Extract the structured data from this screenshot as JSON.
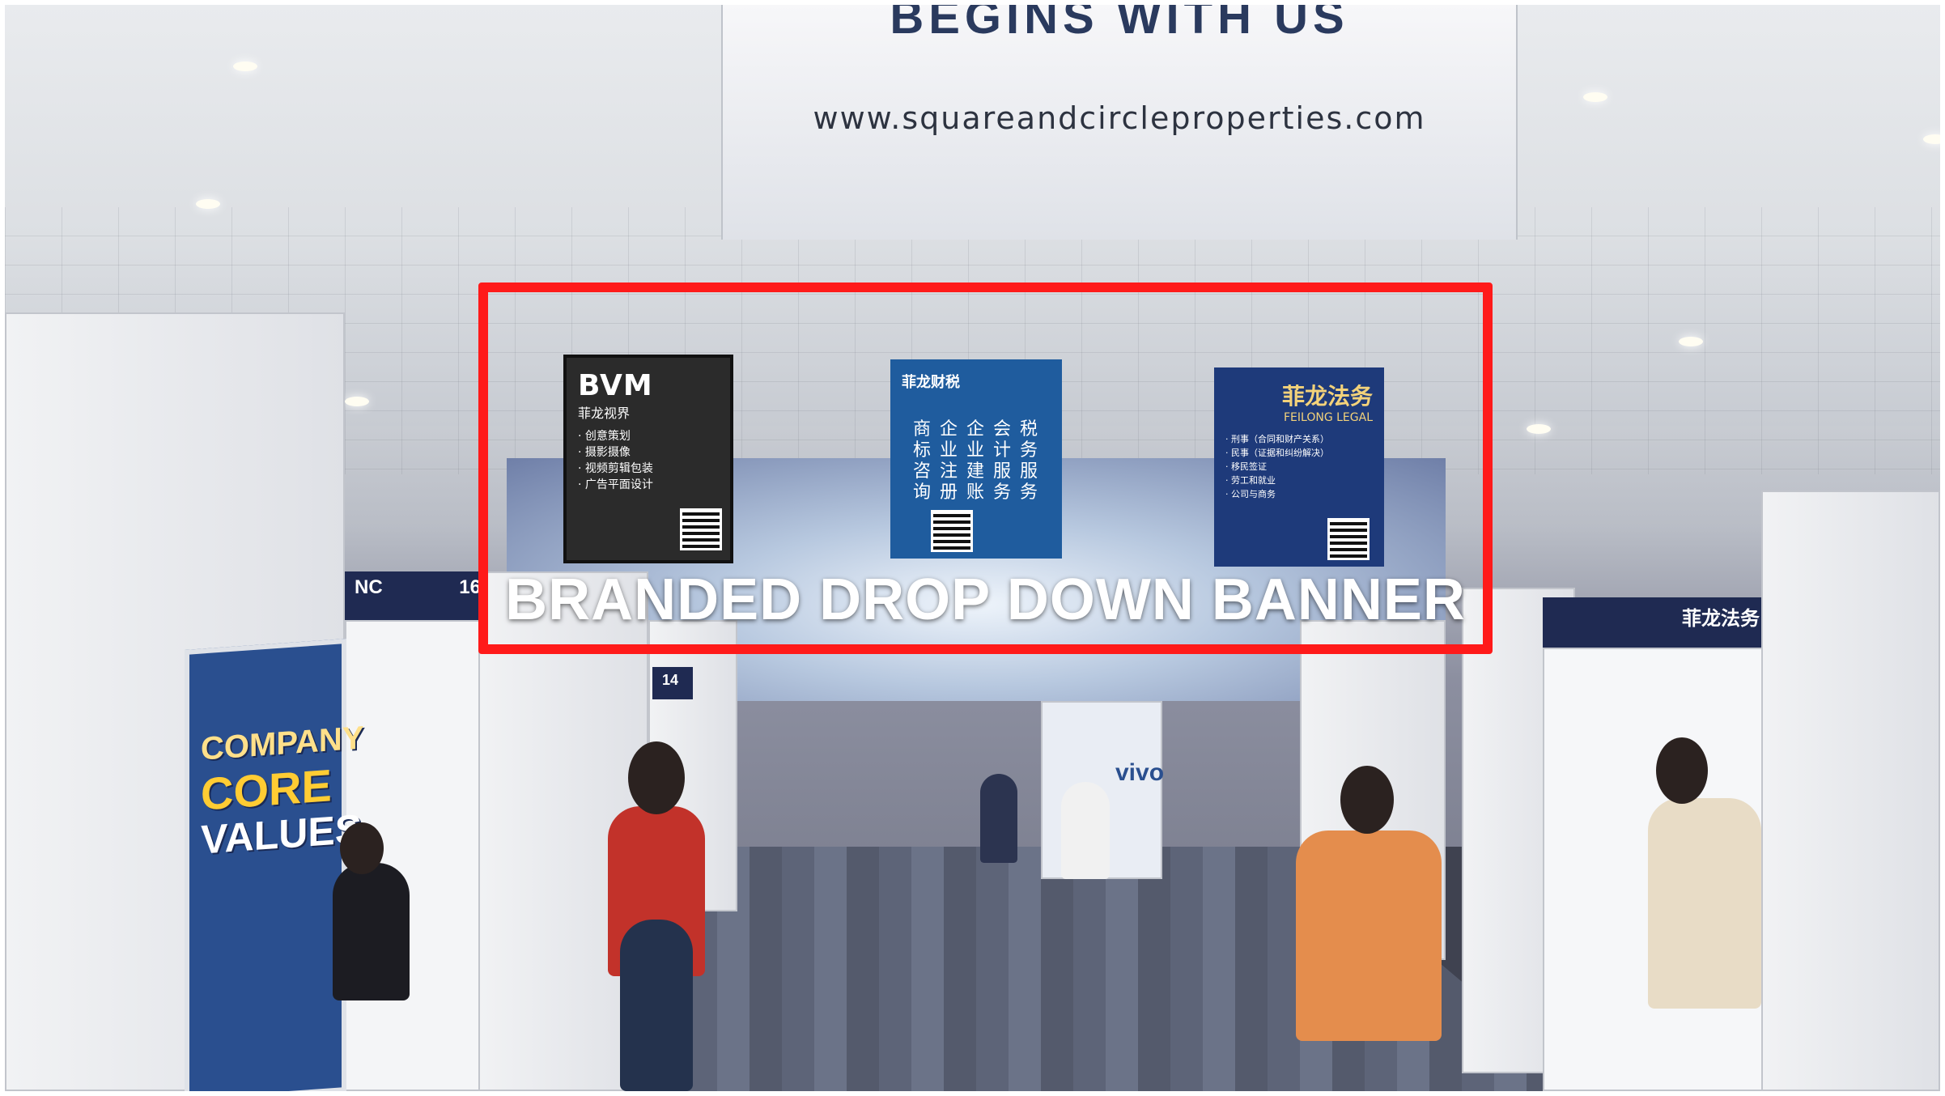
{
  "scene": {
    "description_visible": false,
    "colors": {
      "highlight": "#ff1a1a",
      "caption": "#ffffff"
    }
  },
  "top_banner": {
    "heading": "BEGINS WITH US",
    "url": "www.squareandcircleproperties.com"
  },
  "hanging_banners": [
    {
      "brand": "BVM",
      "subtitle": "菲龙视界",
      "lines": [
        "· 创意策划",
        "· 摄影摄像",
        "· 视频剪辑包装",
        "· 广告平面设计"
      ],
      "color": "#1a1a1a"
    },
    {
      "brand": "菲龙财税",
      "lines": [
        "商 企 企 会 税",
        "标 业 业 计 务",
        "咨 注 建 服 服",
        "询 册 账 务 务"
      ],
      "color": "#1f5c9e"
    },
    {
      "brand": "菲龙法务",
      "subtitle": "FEILONG LEGAL",
      "lines": [
        "· 刑事（合同和财产关系）",
        "· 民事（证据和纠纷解决）",
        "· 移民签证",
        "· 劳工和就业",
        "· 公司与商务"
      ],
      "color": "#1e3a7a"
    }
  ],
  "caption": "BRANDED DROP DOWN BANNER",
  "booths": {
    "left_header": "NC",
    "left_number": "16",
    "right_header": "菲龙法务",
    "center_number": "14",
    "center_right_label": "vivo"
  },
  "poster": {
    "lines": [
      "COMPANY",
      "CORE",
      "VALUES"
    ]
  }
}
